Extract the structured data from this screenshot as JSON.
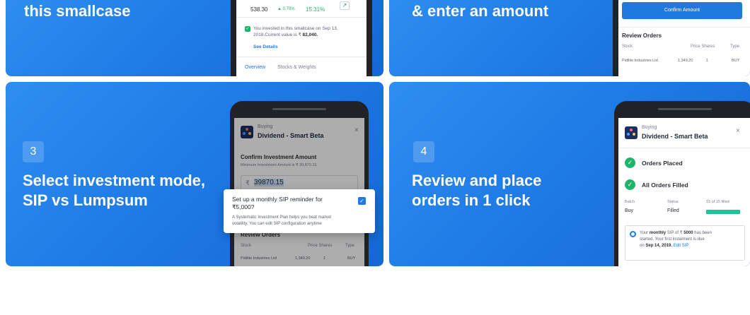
{
  "steps": [
    {
      "headline": "this smallcase"
    },
    {
      "headline": "& enter an amount"
    },
    {
      "number": "3",
      "headline_line1": "Select investment mode,",
      "headline_line2": "SIP vs Lumpsum"
    },
    {
      "number": "4",
      "headline_line1": "Review and place",
      "headline_line2": "orders in 1 click"
    }
  ],
  "phone1": {
    "price": "538.30",
    "change": "▲ 0.70%",
    "return": "15.31%",
    "invested_line1": "You invested in this smallcase on Sep 13,",
    "invested_line2": "2018.Current value is ₹",
    "invested_value": "82,040.",
    "see_details": "See Details",
    "tabs": [
      "Overview",
      "Stocks & Weights"
    ]
  },
  "phone2": {
    "confirm_button": "Confirm Amount",
    "review_title": "Review Orders",
    "col_stock": "Stock",
    "col_price_shares": "Price Shares",
    "col_type": "Type",
    "row_stock": "Pidilite Industries Ltd",
    "row_price": "1,349.20",
    "row_shares": "1",
    "row_type": "BUY"
  },
  "phone3": {
    "buying": "Buying",
    "title": "Dividend - Smart Beta",
    "close": "×",
    "confirm_title": "Confirm Investment Amount",
    "min_amount": "Minimum Investment Amount is ₹ 39,870.15",
    "rupee": "₹",
    "amount_value": "39870.15",
    "review_title": "Review Orders",
    "col_stock": "Stock",
    "col_price_shares": "Price Shares",
    "col_type": "Type",
    "row_stock": "Pidilite Industries Ltd",
    "row_price": "1,349.20",
    "row_shares": "1",
    "row_type": "BUY",
    "popup_title_line1": "Set up a monthly SIP reminder for",
    "popup_title_line2": "₹5,000?",
    "popup_desc_line1": "A Systematic Investment Plan helps you beat market",
    "popup_desc_line2": "volatility. You can edit SIP configuration anytime",
    "popup_checked": true
  },
  "phone4": {
    "buying": "Buying",
    "title": "Dividend - Smart Beta",
    "close": "×",
    "status1": "Orders Placed",
    "status2": "All Orders Filled",
    "batch_label": "Batch",
    "status_label": "Status",
    "filled_count": "15 of 15 filled",
    "batch_value": "Buy",
    "status_value": "Filled",
    "progress": 1.0,
    "notice_pre": "Your",
    "notice_bold": "monthly",
    "notice_mid": "SIP of ₹",
    "notice_amount": "5000",
    "notice_post": "has been",
    "notice_line2": "started. Your first instalment is due",
    "notice_line3_pre": "on",
    "notice_date": "Sep 14, 2019.",
    "notice_link": "Edit SIP"
  },
  "colors": {
    "card_gradient_start": "#2d8ef0",
    "card_gradient_end": "#1567d6",
    "accent_blue": "#1f7ae0",
    "success_green": "#1fb46b",
    "logo_navy": "#1a2f63"
  }
}
